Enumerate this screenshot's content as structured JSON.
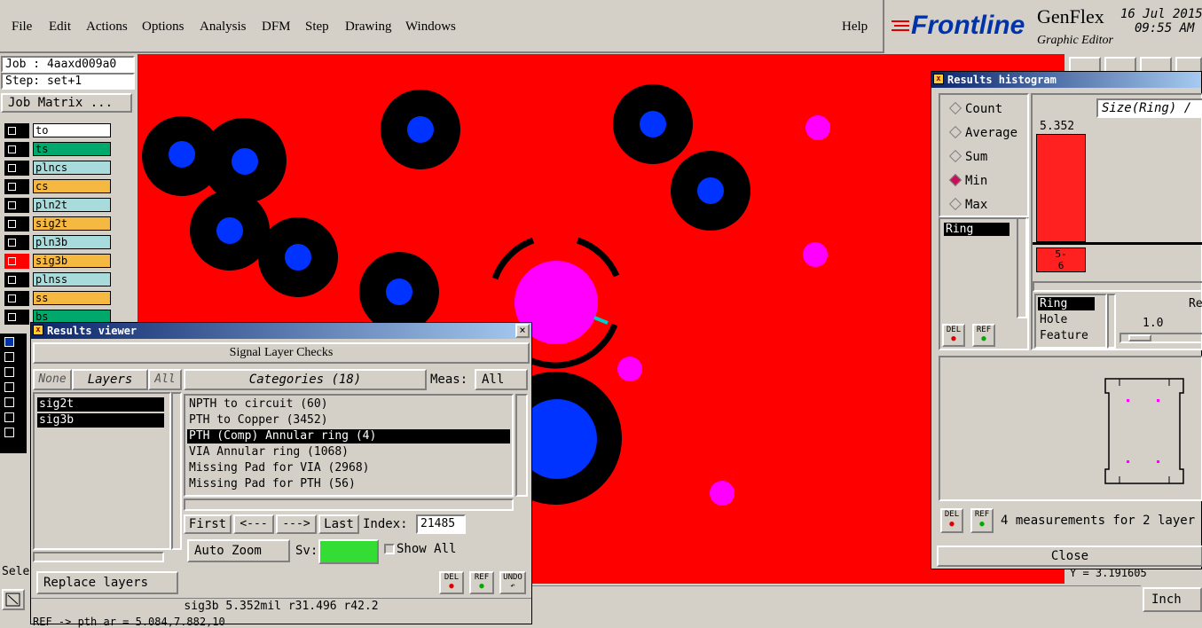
{
  "menubar": {
    "items": [
      "File",
      "Edit",
      "Actions",
      "Options",
      "Analysis",
      "DFM",
      "Step",
      "Drawing",
      "Windows"
    ],
    "help": "Help"
  },
  "brand": {
    "logo": "Frontline",
    "product": "GenFlex",
    "subtitle": "Graphic Editor",
    "date": "16 Jul 2015",
    "time": "09:55 AM"
  },
  "left": {
    "job": "Job : 4aaxd009a0",
    "step": "Step: set+1",
    "job_matrix": "Job Matrix ...",
    "layers": [
      {
        "name": "to",
        "color": "#ffffff"
      },
      {
        "name": "ts",
        "color": "#00a86b"
      },
      {
        "name": "plncs",
        "color": "#a8dcdc"
      },
      {
        "name": "cs",
        "color": "#f5b942"
      },
      {
        "name": "pln2t",
        "color": "#a8dcdc"
      },
      {
        "name": "sig2t",
        "color": "#f5b942"
      },
      {
        "name": "pln3b",
        "color": "#a8dcdc"
      },
      {
        "name": "sig3b",
        "color": "#f5b942"
      },
      {
        "name": "plnss",
        "color": "#a8dcdc"
      },
      {
        "name": "ss",
        "color": "#f5b942"
      },
      {
        "name": "bs",
        "color": "#00a86b"
      }
    ],
    "sele": "Sele"
  },
  "results_viewer": {
    "title": "Results viewer",
    "header": "Signal Layer Checks",
    "none_btn": "None",
    "layers_label": "Layers",
    "all_btn": "All",
    "layers": [
      "sig2t",
      "sig3b"
    ],
    "categories_label": "Categories (18)",
    "meas_label": "Meas:",
    "meas_value": "All",
    "categories": [
      "NPTH to circuit (60)",
      "PTH to Copper (3452)",
      "PTH (Comp) Annular ring (4)",
      "VIA Annular ring (1068)",
      "Missing Pad for VIA (2968)",
      "Missing Pad for PTH (56)"
    ],
    "selected_category": 2,
    "first_btn": "First",
    "prev_btn": "<---",
    "next_btn": "--->",
    "last_btn": "Last",
    "index_label": "Index:",
    "index_value": "21485",
    "auto_zoom": "Auto Zoom",
    "sv_label": "Sv:",
    "show_all": "Show All",
    "replace_layers": "Replace layers",
    "del": "DEL",
    "ref": "REF",
    "undo": "UNDO",
    "status": "sig3b 5.352mil  r31.496  r42.2",
    "status2": "REF -> pth ar = 5.084,7.882,10"
  },
  "histogram": {
    "title": "Results histogram",
    "radios": [
      "Count",
      "Average",
      "Sum",
      "Min",
      "Max"
    ],
    "selected_radio": "Min",
    "axis_title": "Size(Ring) /",
    "bar_value": "5.352",
    "bar_range_top": "5-",
    "bar_range_bottom": "6",
    "list_selected": "Ring",
    "attrs": [
      "Ring",
      "Hole",
      "Feature"
    ],
    "slider_label": "Re",
    "slider_value": "1.0",
    "measurements": "4 measurements for 2 layer",
    "close_btn": "Close"
  },
  "bottom": {
    "units": "Inch",
    "coord": "Y = 3.191605"
  },
  "colors": {
    "canvas": "#ff0000",
    "pad": "#ff00ff",
    "drill": "#0033ff",
    "clearance": "#000000"
  }
}
